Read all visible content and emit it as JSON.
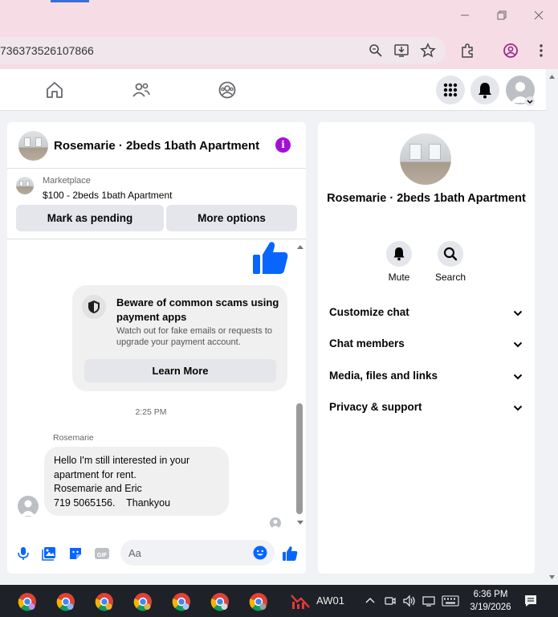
{
  "browser": {
    "url_fragment": "736373526107866"
  },
  "chat": {
    "title": "Rosemarie · 2beds 1bath Apartment",
    "marketplace_label": "Marketplace",
    "listing": "$100 - 2beds 1bath Apartment",
    "mark_pending_label": "Mark as pending",
    "more_options_label": "More options",
    "scam_title": "Beware of common scams using payment apps",
    "scam_body": "Watch out for fake emails or requests to upgrade your payment account.",
    "learn_more_label": "Learn More",
    "timestamp": "2:25 PM",
    "sender": "Rosemarie",
    "message_lines": [
      "Hello I'm still interested in your",
      "apartment for rent.",
      "Rosemarie and Eric",
      "719 5065156.    Thankyou"
    ],
    "composer_placeholder": "Aa"
  },
  "side": {
    "name": "Rosemarie · 2beds 1bath Apartment",
    "mute_label": "Mute",
    "search_label": "Search",
    "sections": [
      "Customize chat",
      "Chat members",
      "Media, files and links",
      "Privacy & support"
    ]
  },
  "taskbar": {
    "app_label": "AW01",
    "time": "6:36 PM",
    "date": "3/19/2026"
  },
  "colors": {
    "accent": "#0866ff",
    "info": "#a40fd6",
    "browser_frame": "#f6dde5",
    "taskbar": "#1f2128"
  }
}
